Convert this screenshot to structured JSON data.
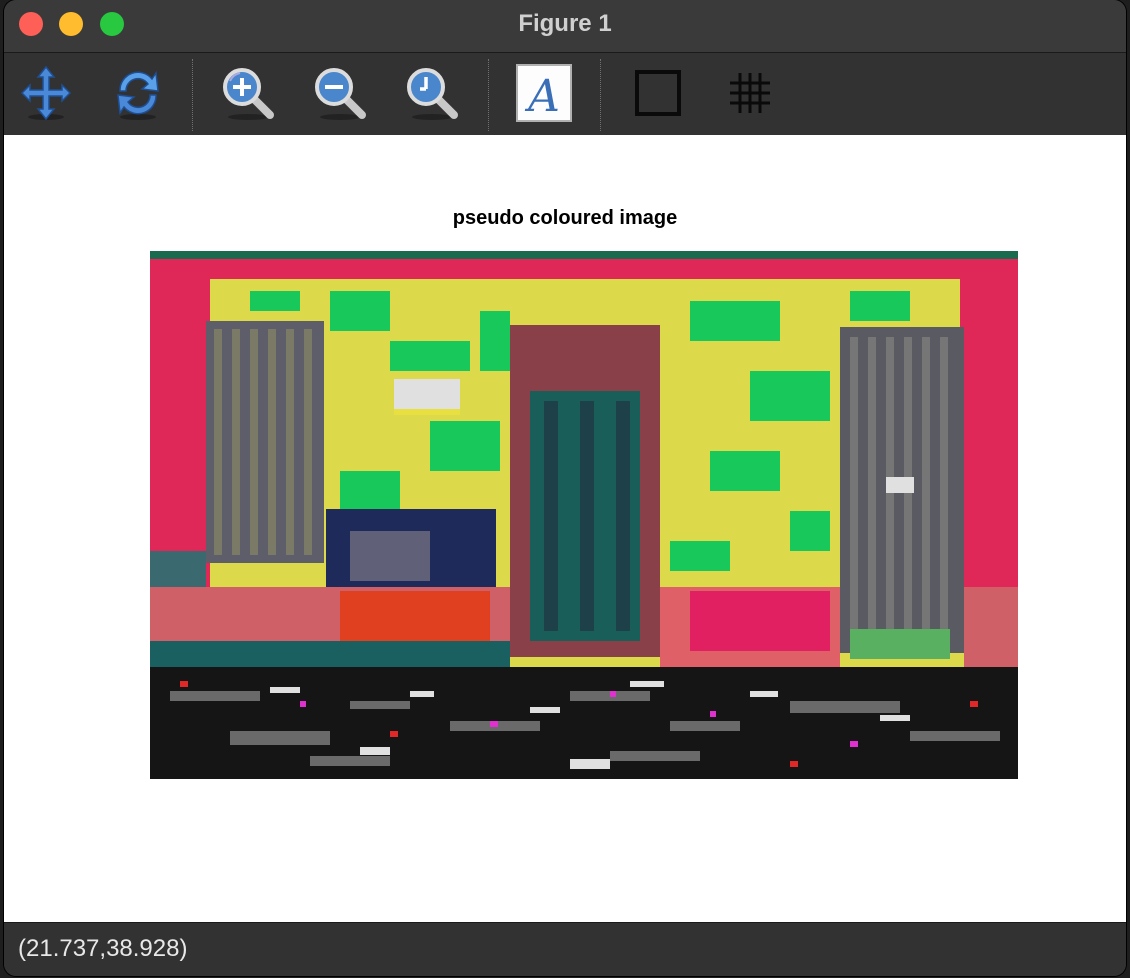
{
  "window": {
    "title": "Figure 1"
  },
  "toolbar": {
    "buttons": [
      {
        "name": "pan",
        "icon": "move-arrows-icon"
      },
      {
        "name": "refresh",
        "icon": "refresh-icon"
      },
      {
        "name": "zoom-in",
        "icon": "zoom-in-icon"
      },
      {
        "name": "zoom-out",
        "icon": "zoom-out-icon"
      },
      {
        "name": "zoom-reset",
        "icon": "zoom-reset-icon"
      },
      {
        "name": "text",
        "icon": "text-a-icon"
      },
      {
        "name": "frame",
        "icon": "frame-square-icon"
      },
      {
        "name": "grid",
        "icon": "grid-icon"
      }
    ]
  },
  "figure": {
    "title": "pseudo coloured image",
    "image_description_palette": [
      "#e8e040",
      "#10d050",
      "#e02050",
      "#606060",
      "#b04050",
      "#202020",
      "#e06060",
      "#1a6060"
    ]
  },
  "status": {
    "coords": "(21.737,38.928)"
  }
}
